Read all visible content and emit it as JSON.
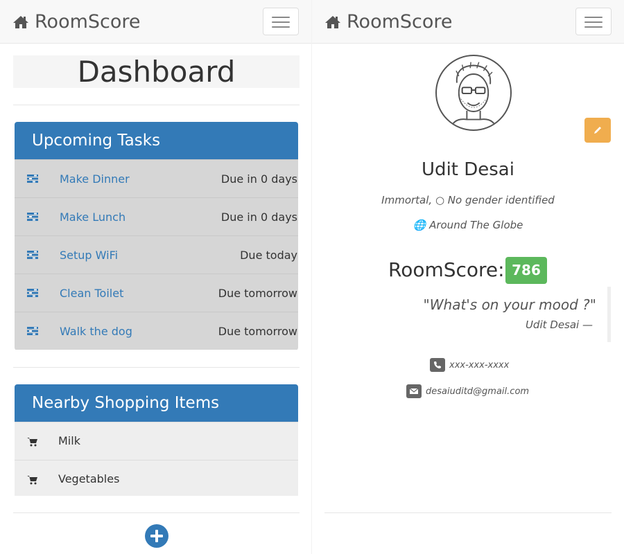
{
  "brand": {
    "name": "RoomScore",
    "icon": "home-icon"
  },
  "dashboard": {
    "title": "Dashboard",
    "tasks_header": "Upcoming Tasks",
    "tasks": [
      {
        "name": "Make Dinner",
        "due": "Due in 0 days",
        "icon": "tasks-icon"
      },
      {
        "name": "Make Lunch",
        "due": "Due in 0 days",
        "icon": "tasks-icon"
      },
      {
        "name": "Setup WiFi",
        "due": "Due today",
        "icon": "tasks-icon"
      },
      {
        "name": "Clean Toilet",
        "due": "Due tomorrow",
        "icon": "tasks-icon"
      },
      {
        "name": "Walk the dog",
        "due": "Due tomorrow",
        "icon": "tasks-icon"
      }
    ],
    "shopping_header": "Nearby Shopping Items",
    "shopping": [
      {
        "name": "Milk",
        "icon": "shopping-cart-icon"
      },
      {
        "name": "Vegetables",
        "icon": "shopping-cart-icon"
      }
    ]
  },
  "profile": {
    "name": "Udit Desai",
    "details": "Immortal, ○ No gender identified",
    "location": "Around The Globe",
    "score_label": "RoomScore:",
    "score": "786",
    "quote": "\"What's on your mood ?\"",
    "quote_author": "Udit Desai —",
    "phone": "xxx-xxx-xxxx",
    "email": "desaiuditd@gmail.com"
  },
  "colors": {
    "primary": "#337ab7",
    "success": "#5cb85c",
    "warning": "#f0ad4e"
  }
}
